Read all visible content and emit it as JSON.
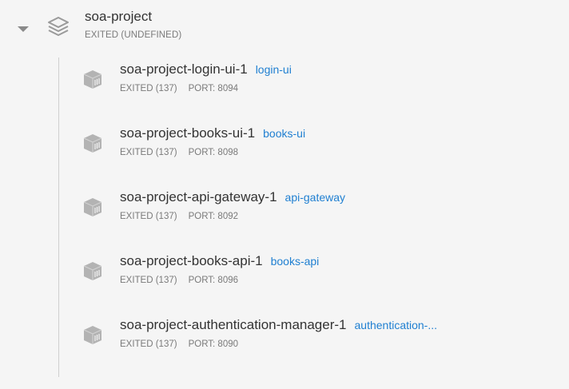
{
  "project": {
    "name": "soa-project",
    "status": "EXITED (UNDEFINED)",
    "icon": "stack-icon"
  },
  "containers": [
    {
      "name": "soa-project-login-ui-1",
      "image": "login-ui",
      "status": "EXITED (137)",
      "port": "PORT: 8094",
      "icon": "container-icon"
    },
    {
      "name": "soa-project-books-ui-1",
      "image": "books-ui",
      "status": "EXITED (137)",
      "port": "PORT: 8098",
      "icon": "container-icon"
    },
    {
      "name": "soa-project-api-gateway-1",
      "image": "api-gateway",
      "status": "EXITED (137)",
      "port": "PORT: 8092",
      "icon": "container-icon"
    },
    {
      "name": "soa-project-books-api-1",
      "image": "books-api",
      "status": "EXITED (137)",
      "port": "PORT: 8096",
      "icon": "container-icon"
    },
    {
      "name": "soa-project-authentication-manager-1",
      "image": "authentication-...",
      "status": "EXITED (137)",
      "port": "PORT: 8090",
      "icon": "container-icon"
    }
  ],
  "colors": {
    "background": "#f5f5f5",
    "text": "#333333",
    "muted": "#7a7a7a",
    "link": "#1f7fd1",
    "icon": "#b0b0b0"
  }
}
